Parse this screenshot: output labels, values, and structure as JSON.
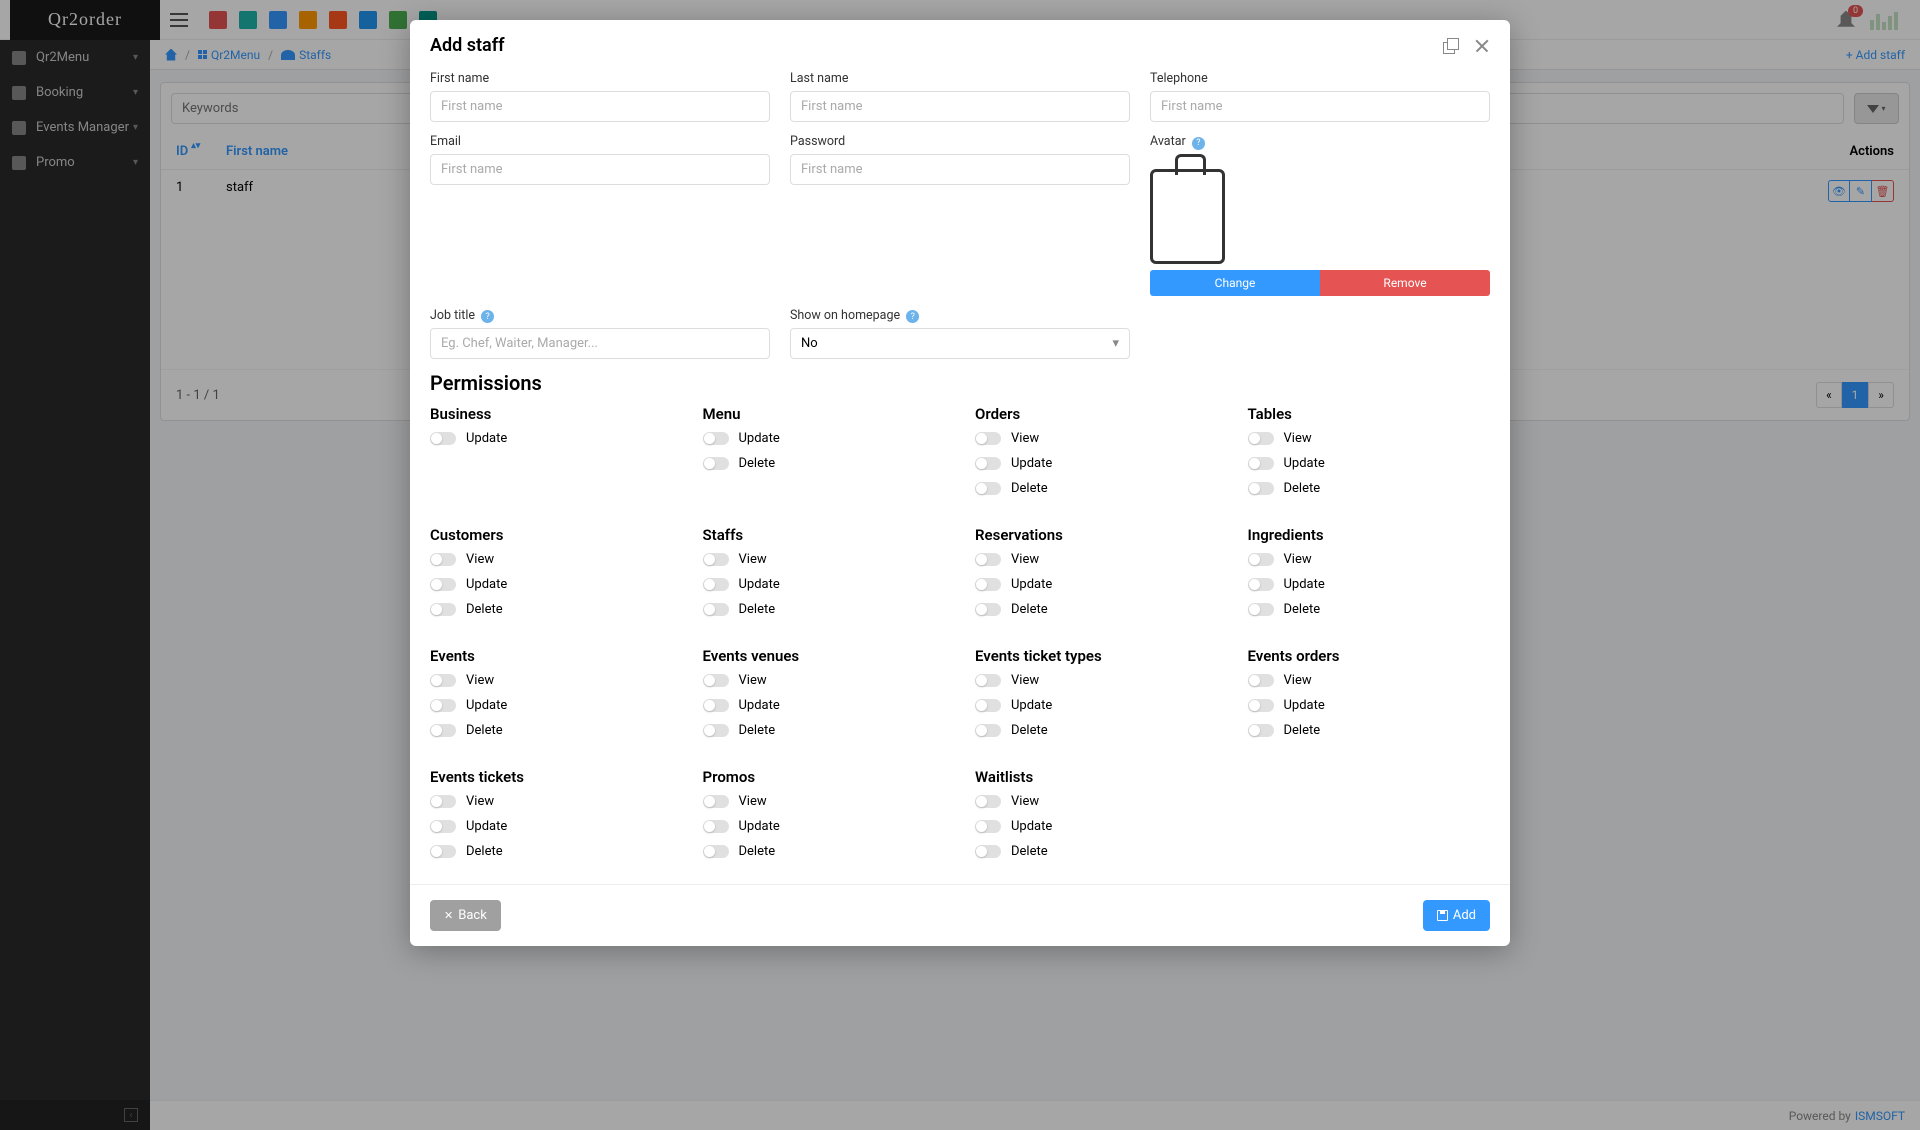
{
  "app": {
    "logo": "Qr2order",
    "notification_count": "0"
  },
  "sidebar": {
    "items": [
      {
        "label": "Qr2Menu"
      },
      {
        "label": "Booking"
      },
      {
        "label": "Events Manager"
      },
      {
        "label": "Promo"
      }
    ]
  },
  "breadcrumb": {
    "item1": "Qr2Menu",
    "item2": "Staffs",
    "add_staff": "+ Add staff"
  },
  "search": {
    "placeholder": "Keywords"
  },
  "table": {
    "headers": {
      "id": "ID",
      "first_name": "First name",
      "actions": "Actions"
    },
    "rows": [
      {
        "id": "1",
        "first_name": "staff"
      }
    ],
    "page_info": "1 - 1 / 1",
    "prev": "«",
    "page1": "1",
    "next": "»"
  },
  "footer": {
    "powered": "Powered by",
    "company": "ISMSOFT"
  },
  "modal": {
    "title": "Add staff",
    "fields": {
      "first_name": {
        "label": "First name",
        "placeholder": "First name"
      },
      "last_name": {
        "label": "Last name",
        "placeholder": "First name"
      },
      "telephone": {
        "label": "Telephone",
        "placeholder": "First name"
      },
      "email": {
        "label": "Email",
        "placeholder": "First name"
      },
      "password": {
        "label": "Password",
        "placeholder": "First name"
      },
      "avatar": {
        "label": "Avatar",
        "change": "Change",
        "remove": "Remove"
      },
      "job_title": {
        "label": "Job title",
        "placeholder": "Eg. Chef, Waiter, Manager..."
      },
      "show_home": {
        "label": "Show on homepage",
        "value": "No"
      }
    },
    "permissions_title": "Permissions",
    "perm_labels": {
      "view": "View",
      "update": "Update",
      "delete": "Delete"
    },
    "perm_groups": {
      "business": "Business",
      "menu": "Menu",
      "orders": "Orders",
      "tables": "Tables",
      "customers": "Customers",
      "staffs": "Staffs",
      "reservations": "Reservations",
      "ingredients": "Ingredients",
      "events": "Events",
      "events_venues": "Events venues",
      "events_ticket_types": "Events ticket types",
      "events_orders": "Events orders",
      "events_tickets": "Events tickets",
      "promos": "Promos",
      "waitlists": "Waitlists"
    },
    "buttons": {
      "back": "Back",
      "add": "Add"
    },
    "help": "?"
  }
}
